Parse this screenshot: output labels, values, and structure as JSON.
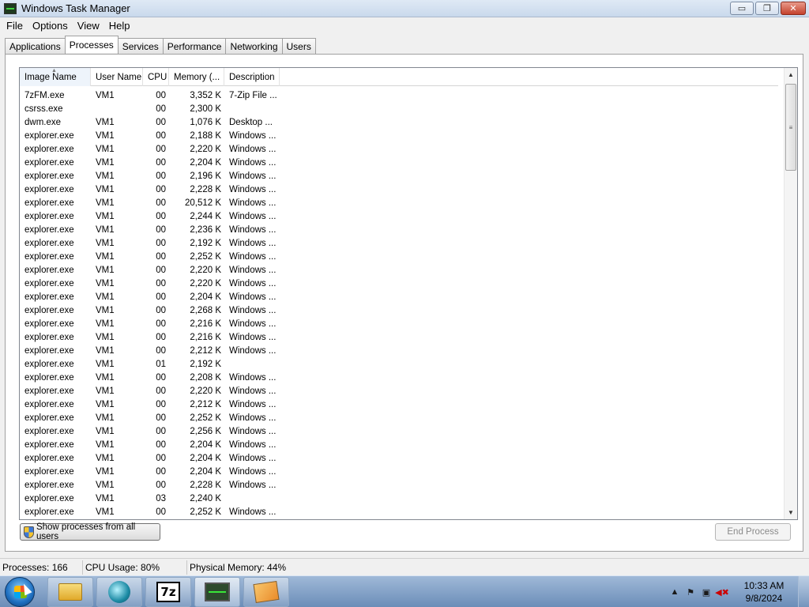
{
  "window": {
    "title": "Windows Task Manager",
    "min_symbol": "▭",
    "max_symbol": "❐",
    "close_symbol": "✕"
  },
  "menu": [
    "File",
    "Options",
    "View",
    "Help"
  ],
  "tabs": [
    "Applications",
    "Processes",
    "Services",
    "Performance",
    "Networking",
    "Users"
  ],
  "active_tab": "Processes",
  "columns": [
    "Image Name",
    "User Name",
    "CPU",
    "Memory (...",
    "Description"
  ],
  "sorted_column": "Image Name",
  "processes": [
    {
      "name": "7zFM.exe",
      "user": "VM1",
      "cpu": "00",
      "mem": "3,352 K",
      "desc": "7-Zip File ..."
    },
    {
      "name": "csrss.exe",
      "user": "",
      "cpu": "00",
      "mem": "2,300 K",
      "desc": ""
    },
    {
      "name": "dwm.exe",
      "user": "VM1",
      "cpu": "00",
      "mem": "1,076 K",
      "desc": "Desktop ..."
    },
    {
      "name": "explorer.exe",
      "user": "VM1",
      "cpu": "00",
      "mem": "2,188 K",
      "desc": "Windows ..."
    },
    {
      "name": "explorer.exe",
      "user": "VM1",
      "cpu": "00",
      "mem": "2,220 K",
      "desc": "Windows ..."
    },
    {
      "name": "explorer.exe",
      "user": "VM1",
      "cpu": "00",
      "mem": "2,204 K",
      "desc": "Windows ..."
    },
    {
      "name": "explorer.exe",
      "user": "VM1",
      "cpu": "00",
      "mem": "2,196 K",
      "desc": "Windows ..."
    },
    {
      "name": "explorer.exe",
      "user": "VM1",
      "cpu": "00",
      "mem": "2,228 K",
      "desc": "Windows ..."
    },
    {
      "name": "explorer.exe",
      "user": "VM1",
      "cpu": "00",
      "mem": "20,512 K",
      "desc": "Windows ..."
    },
    {
      "name": "explorer.exe",
      "user": "VM1",
      "cpu": "00",
      "mem": "2,244 K",
      "desc": "Windows ..."
    },
    {
      "name": "explorer.exe",
      "user": "VM1",
      "cpu": "00",
      "mem": "2,236 K",
      "desc": "Windows ..."
    },
    {
      "name": "explorer.exe",
      "user": "VM1",
      "cpu": "00",
      "mem": "2,192 K",
      "desc": "Windows ..."
    },
    {
      "name": "explorer.exe",
      "user": "VM1",
      "cpu": "00",
      "mem": "2,252 K",
      "desc": "Windows ..."
    },
    {
      "name": "explorer.exe",
      "user": "VM1",
      "cpu": "00",
      "mem": "2,220 K",
      "desc": "Windows ..."
    },
    {
      "name": "explorer.exe",
      "user": "VM1",
      "cpu": "00",
      "mem": "2,220 K",
      "desc": "Windows ..."
    },
    {
      "name": "explorer.exe",
      "user": "VM1",
      "cpu": "00",
      "mem": "2,204 K",
      "desc": "Windows ..."
    },
    {
      "name": "explorer.exe",
      "user": "VM1",
      "cpu": "00",
      "mem": "2,268 K",
      "desc": "Windows ..."
    },
    {
      "name": "explorer.exe",
      "user": "VM1",
      "cpu": "00",
      "mem": "2,216 K",
      "desc": "Windows ..."
    },
    {
      "name": "explorer.exe",
      "user": "VM1",
      "cpu": "00",
      "mem": "2,216 K",
      "desc": "Windows ..."
    },
    {
      "name": "explorer.exe",
      "user": "VM1",
      "cpu": "00",
      "mem": "2,212 K",
      "desc": "Windows ..."
    },
    {
      "name": "explorer.exe",
      "user": "VM1",
      "cpu": "01",
      "mem": "2,192 K",
      "desc": ""
    },
    {
      "name": "explorer.exe",
      "user": "VM1",
      "cpu": "00",
      "mem": "2,208 K",
      "desc": "Windows ..."
    },
    {
      "name": "explorer.exe",
      "user": "VM1",
      "cpu": "00",
      "mem": "2,220 K",
      "desc": "Windows ..."
    },
    {
      "name": "explorer.exe",
      "user": "VM1",
      "cpu": "00",
      "mem": "2,212 K",
      "desc": "Windows ..."
    },
    {
      "name": "explorer.exe",
      "user": "VM1",
      "cpu": "00",
      "mem": "2,252 K",
      "desc": "Windows ..."
    },
    {
      "name": "explorer.exe",
      "user": "VM1",
      "cpu": "00",
      "mem": "2,256 K",
      "desc": "Windows ..."
    },
    {
      "name": "explorer.exe",
      "user": "VM1",
      "cpu": "00",
      "mem": "2,204 K",
      "desc": "Windows ..."
    },
    {
      "name": "explorer.exe",
      "user": "VM1",
      "cpu": "00",
      "mem": "2,204 K",
      "desc": "Windows ..."
    },
    {
      "name": "explorer.exe",
      "user": "VM1",
      "cpu": "00",
      "mem": "2,204 K",
      "desc": "Windows ..."
    },
    {
      "name": "explorer.exe",
      "user": "VM1",
      "cpu": "00",
      "mem": "2,228 K",
      "desc": "Windows ..."
    },
    {
      "name": "explorer.exe",
      "user": "VM1",
      "cpu": "03",
      "mem": "2,240 K",
      "desc": ""
    },
    {
      "name": "explorer.exe",
      "user": "VM1",
      "cpu": "00",
      "mem": "2,252 K",
      "desc": "Windows ..."
    }
  ],
  "buttons": {
    "show_all_users": "Show processes from all users",
    "end_process": "End Process"
  },
  "status": {
    "processes": "Processes: 166",
    "cpu": "CPU Usage: 80%",
    "memory": "Physical Memory: 44%"
  },
  "taskbar": {
    "items": [
      {
        "name": "windows-explorer",
        "icon": "folder-icon"
      },
      {
        "name": "media-app",
        "icon": "media-icon"
      },
      {
        "name": "7zip",
        "icon": "sevenzip-icon",
        "label": "7z"
      },
      {
        "name": "task-manager",
        "icon": "taskmgr-icon"
      },
      {
        "name": "image-viewer",
        "icon": "viewer-icon"
      }
    ],
    "tray_up_arrow": "▲",
    "flag_glyph": "⚑",
    "network_glyph": "▣",
    "volume_glyph": "◀✖",
    "time": "10:33 AM",
    "date": "9/8/2024"
  },
  "colors": {
    "accent": "#3399ff",
    "titlebar": "#c9d9ec",
    "taskbar": "#6b8db8"
  }
}
